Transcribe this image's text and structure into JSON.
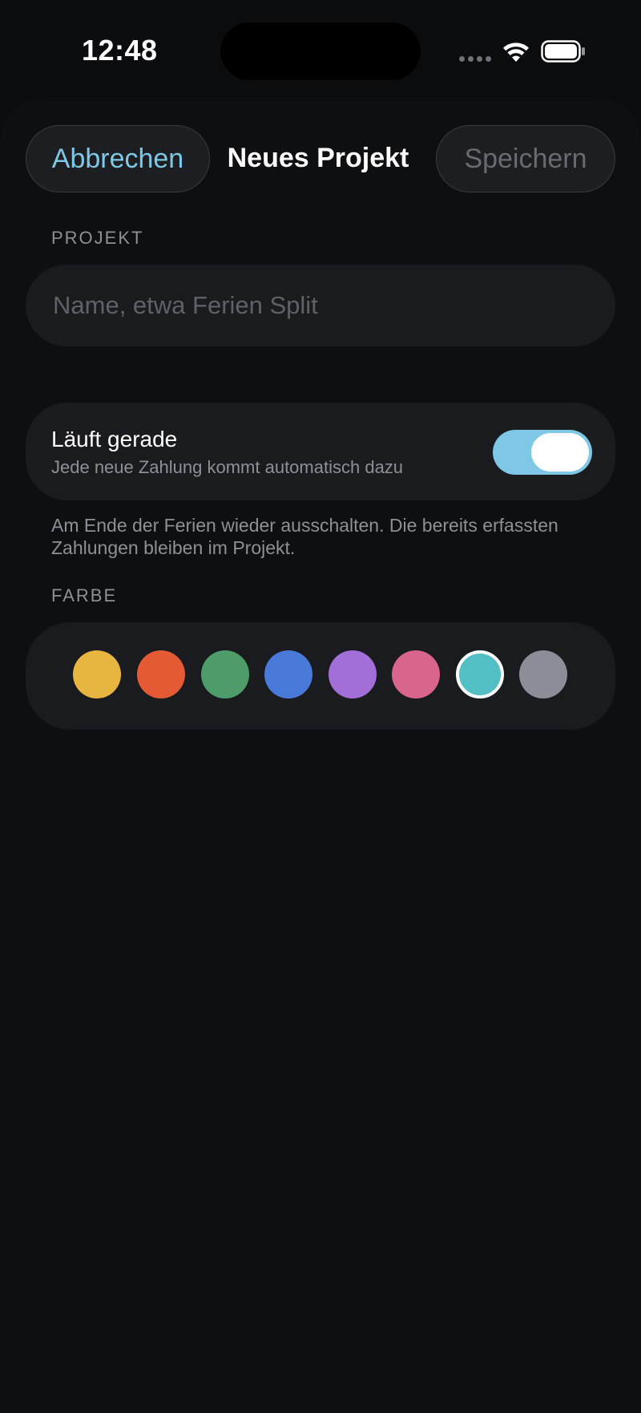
{
  "status_bar": {
    "time": "12:48"
  },
  "nav": {
    "cancel_label": "Abbrechen",
    "title": "Neues Projekt",
    "save_label": "Speichern"
  },
  "project_section": {
    "label": "PROJEKT",
    "name_field": {
      "value": "",
      "placeholder": "Name, etwa Ferien Split"
    }
  },
  "running_toggle": {
    "title": "Läuft gerade",
    "subtitle": "Jede neue Zahlung kommt automatisch dazu",
    "on": true,
    "footnote": "Am Ende der Ferien wieder ausschalten. Die bereits erfassten Zahlungen bleiben im Projekt."
  },
  "color_section": {
    "label": "FARBE",
    "swatches": [
      {
        "name": "yellow",
        "hex": "#e8b540",
        "selected": false
      },
      {
        "name": "orange",
        "hex": "#e35a35",
        "selected": false
      },
      {
        "name": "green",
        "hex": "#4e9c6a",
        "selected": false
      },
      {
        "name": "blue",
        "hex": "#4a7ad9",
        "selected": false
      },
      {
        "name": "purple",
        "hex": "#a26fd8",
        "selected": false
      },
      {
        "name": "pink",
        "hex": "#d9658d",
        "selected": false
      },
      {
        "name": "teal",
        "hex": "#52bfc4",
        "selected": true
      },
      {
        "name": "gray",
        "hex": "#8b8e96",
        "selected": false
      }
    ]
  },
  "colors": {
    "accent": "#7ec8e6",
    "background": "#0b0c0e",
    "card": "#1a1b1e",
    "secondary_text": "#8e9096"
  }
}
